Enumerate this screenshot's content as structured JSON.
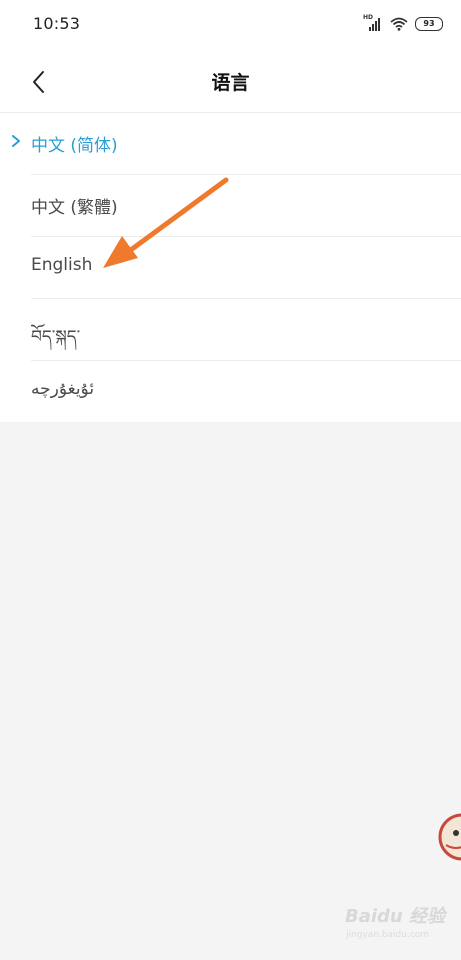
{
  "status_bar": {
    "time": "10:53",
    "network_label": "HD",
    "battery_level": "93"
  },
  "header": {
    "title": "语言"
  },
  "languages": [
    {
      "label": "中文 (简体)",
      "selected": true
    },
    {
      "label": "中文 (繁體)",
      "selected": false
    },
    {
      "label": "English",
      "selected": false
    },
    {
      "label": "བོད་སྐད་",
      "selected": false
    },
    {
      "label": "ئۇيغۇرچە",
      "selected": false
    }
  ],
  "colors": {
    "accent": "#2a9fd6",
    "annotation_arrow": "#f07a2c",
    "background": "#f4f4f4"
  },
  "icons": {
    "back": "chevron-left-icon",
    "selected": "chevron-right-icon",
    "wifi": "wifi-icon",
    "signal": "signal-icon",
    "battery": "battery-icon"
  },
  "watermark": {
    "text": "Baidu 经验",
    "sub": "jingyan.baidu.com"
  }
}
